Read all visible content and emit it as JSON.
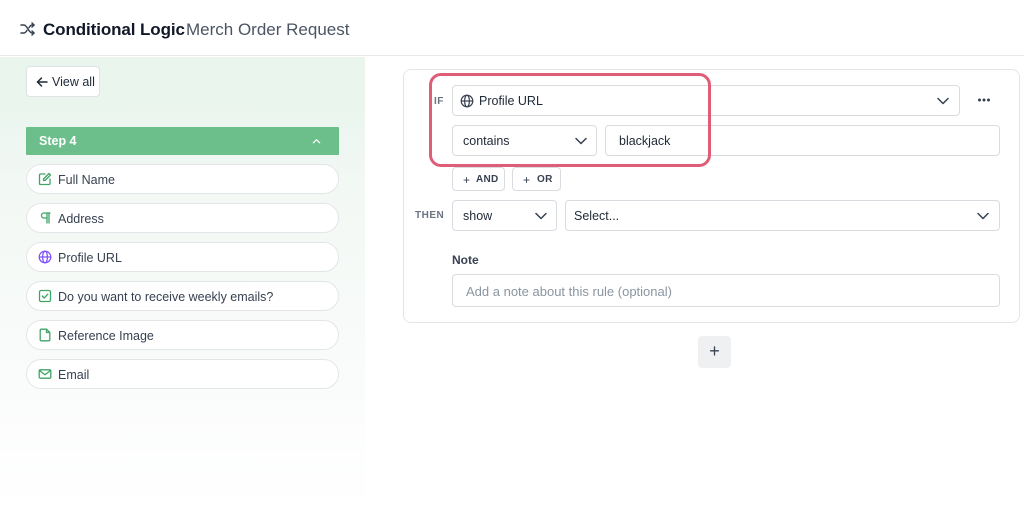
{
  "header": {
    "title": "Conditional Logic",
    "subtitle": "Merch Order Request"
  },
  "sidebar": {
    "view_all": "View all",
    "step": "Step 4",
    "fields": [
      {
        "label": "Full Name",
        "icon": "edit-icon"
      },
      {
        "label": "Address",
        "icon": "paragraph-icon"
      },
      {
        "label": "Profile URL",
        "icon": "globe-icon"
      },
      {
        "label": "Do you want to receive weekly emails?",
        "icon": "checkbox-icon"
      },
      {
        "label": "Reference Image",
        "icon": "file-icon"
      },
      {
        "label": "Email",
        "icon": "mail-icon"
      }
    ]
  },
  "rule": {
    "if_label": "IF",
    "field_value": "Profile URL",
    "operator": "contains",
    "value": "blackjack",
    "and_label": "AND",
    "or_label": "OR",
    "then_label": "THEN",
    "action": "show",
    "target_placeholder": "Select...",
    "note_label": "Note",
    "note_placeholder": "Add a note about this rule (optional)"
  },
  "colors": {
    "accent": "#6cbf8a",
    "highlight": "#e05d77",
    "icon_purple": "#7c4dff",
    "icon_green": "#3fa565"
  }
}
